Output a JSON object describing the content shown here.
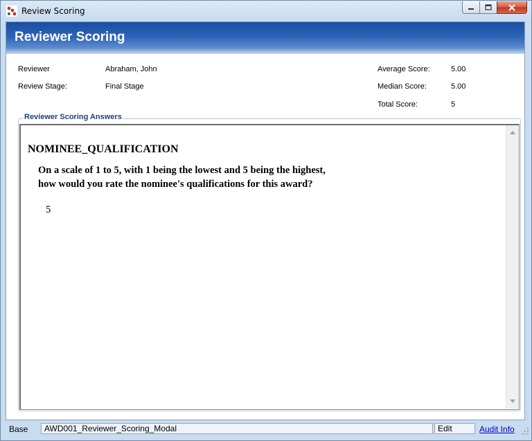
{
  "window": {
    "title": "Review Scoring",
    "controls": {
      "minimize_icon": "minimize-icon",
      "maximize_icon": "maximize-icon",
      "close_icon": "close-icon"
    }
  },
  "header": {
    "title": "Reviewer Scoring"
  },
  "info": {
    "reviewer_label": "Reviewer",
    "reviewer_value": "Abraham, John",
    "stage_label": "Review Stage:",
    "stage_value": "Final Stage",
    "average_label": "Average Score:",
    "average_value": "5.00",
    "median_label": "Median Score:",
    "median_value": "5.00",
    "total_label": "Total Score:",
    "total_value": "5"
  },
  "answers": {
    "legend": "Reviewer Scoring Answers",
    "items": [
      {
        "code": "NOMINEE_QUALIFICATION",
        "question": "On a scale of 1 to 5, with 1 being the lowest and 5 being the highest, how would you rate the nominee's qualifications for this award?",
        "answer": "5"
      }
    ]
  },
  "status": {
    "base": "Base",
    "form_name": "AWD001_Reviewer_Scoring_Modal",
    "mode": "Edit",
    "audit_link": "Audit Info"
  },
  "colors": {
    "header_gradient_top": "#1b4da0",
    "header_gradient_bottom": "#c9d9ee",
    "legend_text": "#1f3f73",
    "link": "#0000cc",
    "close_button": "#c0391e"
  }
}
